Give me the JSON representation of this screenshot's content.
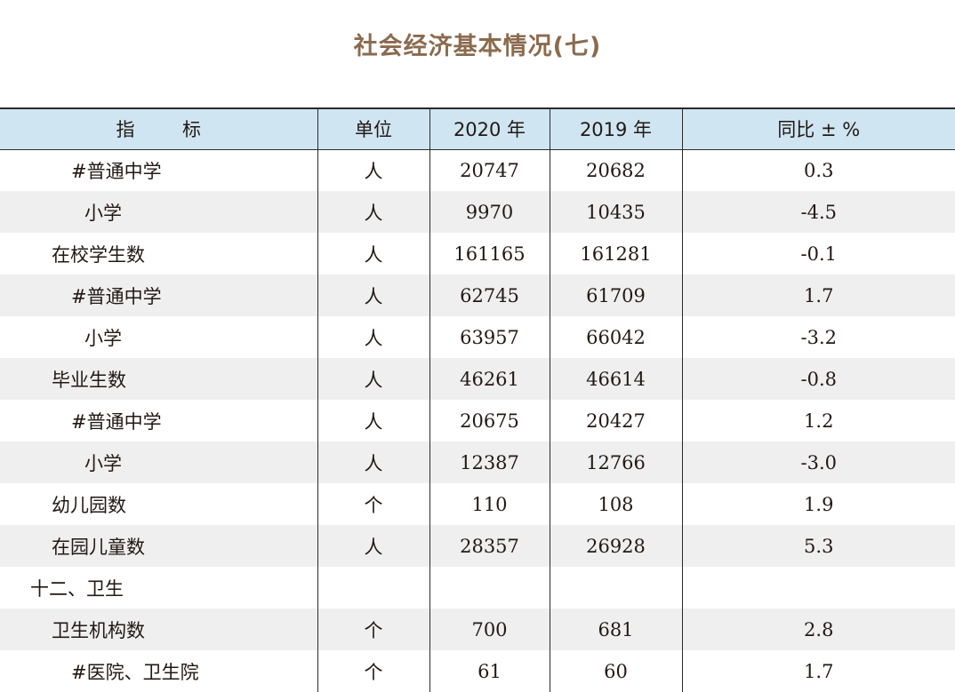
{
  "title": "社会经济基本情况(七)",
  "columns": {
    "indicator": "指        标",
    "unit": "单位",
    "y2020": "2020 年",
    "y2019": "2019 年",
    "yoy": "同比 ± %"
  },
  "rows": [
    {
      "indicator": "#普通中学",
      "unit": "人",
      "y2020": "20747",
      "y2019": "20682",
      "yoy": "0.3"
    },
    {
      "indicator": "小学",
      "unit": "人",
      "y2020": "9970",
      "y2019": "10435",
      "yoy": "-4.5"
    },
    {
      "indicator": "在校学生数",
      "unit": "人",
      "y2020": "161165",
      "y2019": "161281",
      "yoy": "-0.1"
    },
    {
      "indicator": "#普通中学",
      "unit": "人",
      "y2020": "62745",
      "y2019": "61709",
      "yoy": "1.7"
    },
    {
      "indicator": "小学",
      "unit": "人",
      "y2020": "63957",
      "y2019": "66042",
      "yoy": "-3.2"
    },
    {
      "indicator": "毕业生数",
      "unit": "人",
      "y2020": "46261",
      "y2019": "46614",
      "yoy": "-0.8"
    },
    {
      "indicator": "#普通中学",
      "unit": "人",
      "y2020": "20675",
      "y2019": "20427",
      "yoy": "1.2"
    },
    {
      "indicator": "小学",
      "unit": "人",
      "y2020": "12387",
      "y2019": "12766",
      "yoy": "-3.0"
    },
    {
      "indicator": "幼儿园数",
      "unit": "个",
      "y2020": "110",
      "y2019": "108",
      "yoy": "1.9"
    },
    {
      "indicator": "在园儿童数",
      "unit": "人",
      "y2020": "28357",
      "y2019": "26928",
      "yoy": "5.3"
    },
    {
      "indicator": "十二、卫生",
      "unit": "",
      "y2020": "",
      "y2019": "",
      "yoy": ""
    },
    {
      "indicator": "卫生机构数",
      "unit": "个",
      "y2020": "700",
      "y2019": "681",
      "yoy": "2.8"
    },
    {
      "indicator": "#医院、卫生院",
      "unit": "个",
      "y2020": "61",
      "y2019": "60",
      "yoy": "1.7"
    }
  ]
}
